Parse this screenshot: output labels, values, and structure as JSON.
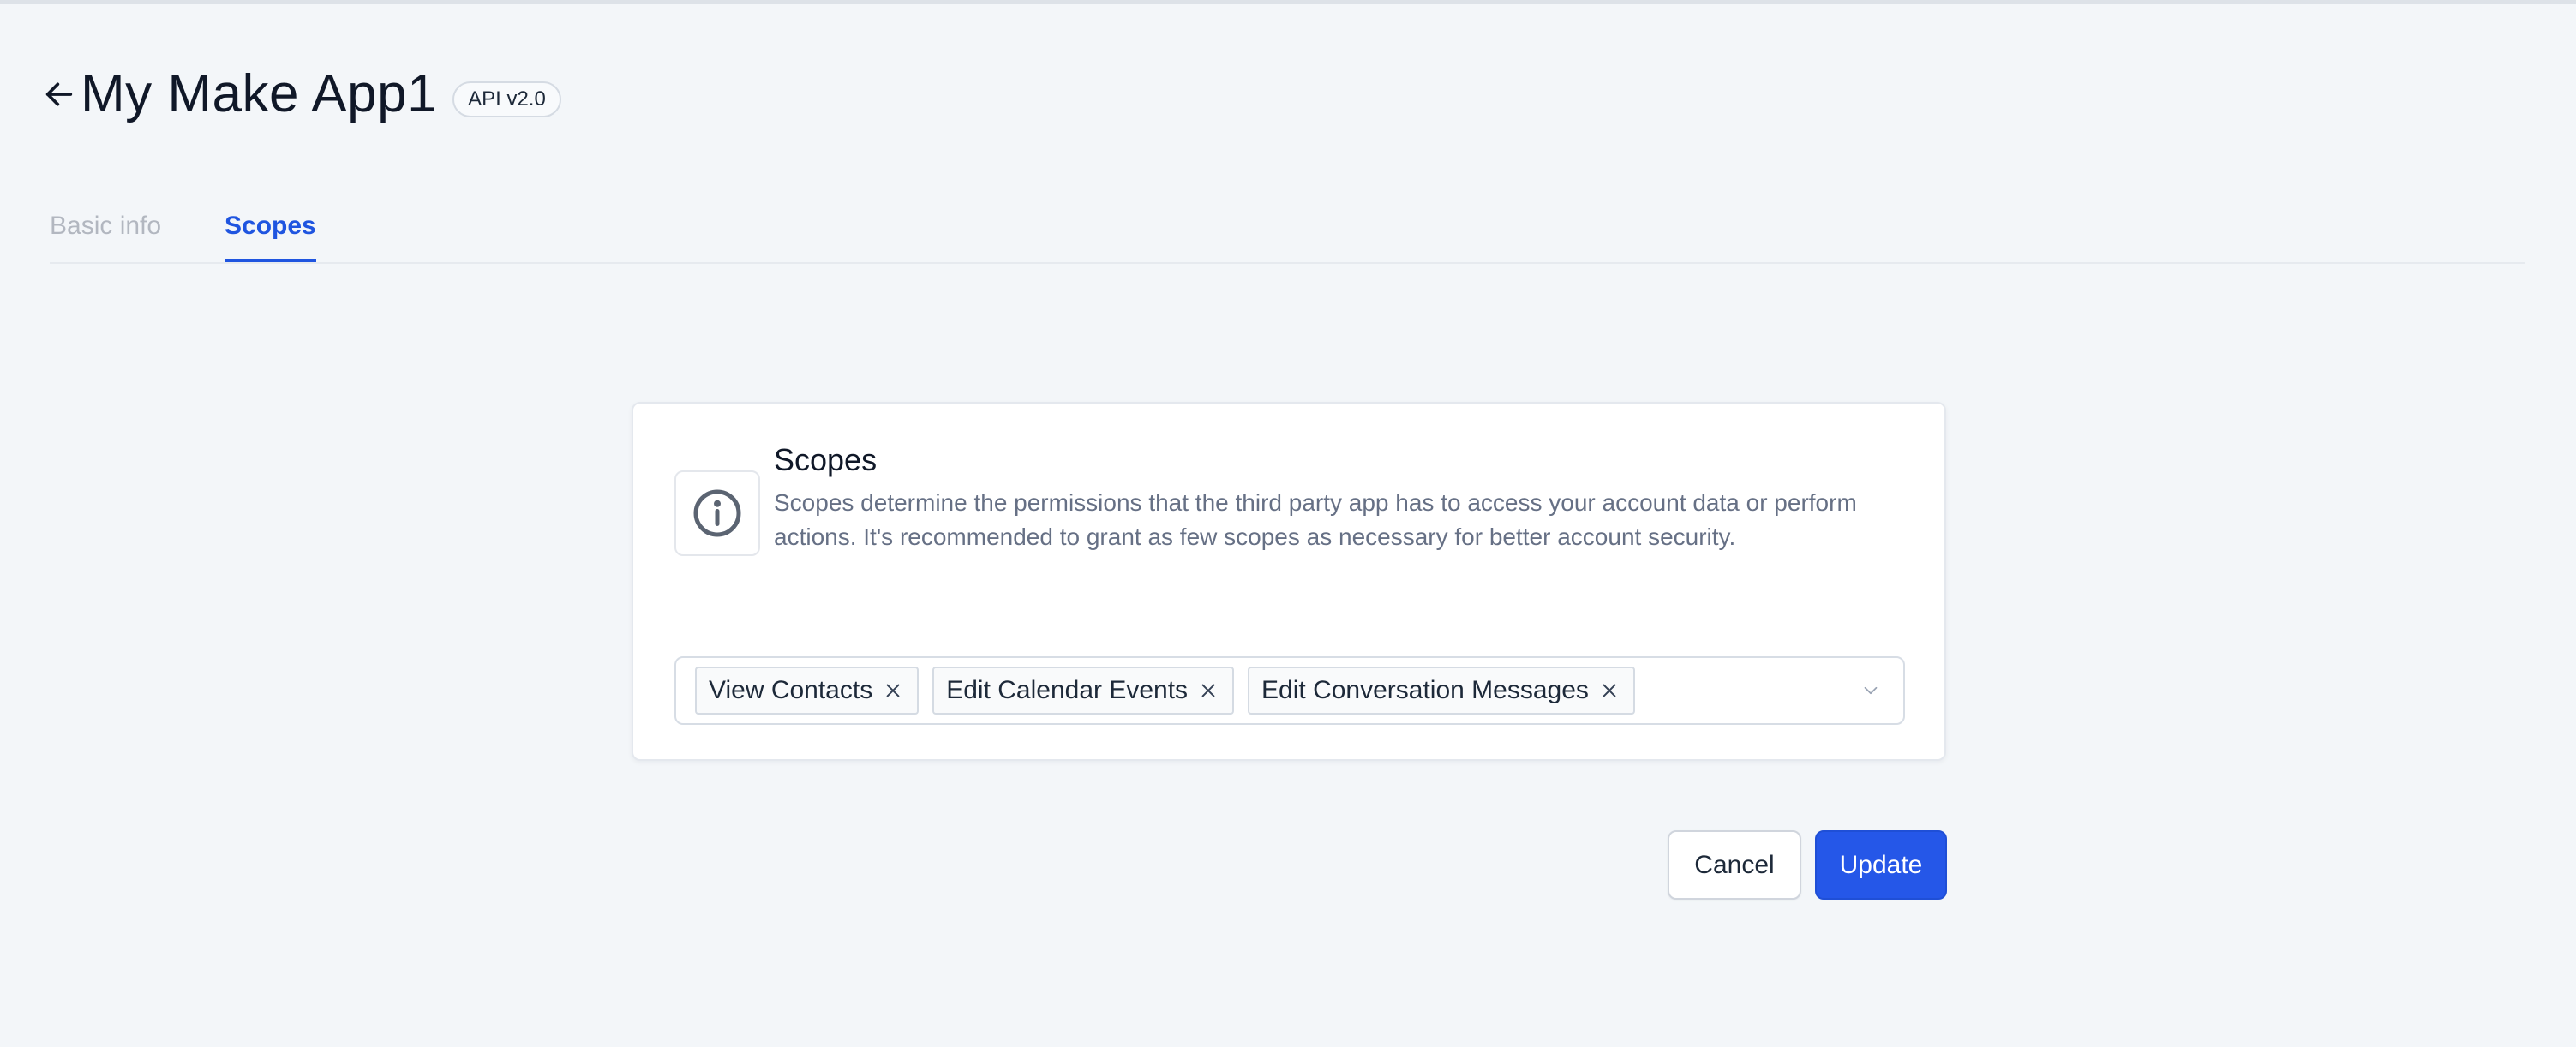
{
  "header": {
    "back_icon": "arrow-left-icon",
    "title": "My Make App1",
    "api_badge": "API v2.0"
  },
  "tabs": [
    {
      "label": "Basic info",
      "active": false
    },
    {
      "label": "Scopes",
      "active": true
    }
  ],
  "scopes_card": {
    "info_icon": "info-circle-icon",
    "title": "Scopes",
    "description": "Scopes determine the permissions that the third party app has to access your account data or perform actions. It's recommended to grant as few scopes as necessary for better account security.",
    "selected_scopes": [
      {
        "label": "View Contacts",
        "remove_icon": "close-icon"
      },
      {
        "label": "Edit Calendar Events",
        "remove_icon": "close-icon"
      },
      {
        "label": "Edit Conversation Messages",
        "remove_icon": "close-icon"
      }
    ],
    "dropdown_icon": "chevron-down-icon"
  },
  "actions": {
    "cancel_label": "Cancel",
    "update_label": "Update"
  },
  "colors": {
    "background": "#f3f6f9",
    "accent": "#1f55e0",
    "primary_button": "#2557e8",
    "muted_text": "#667085"
  }
}
